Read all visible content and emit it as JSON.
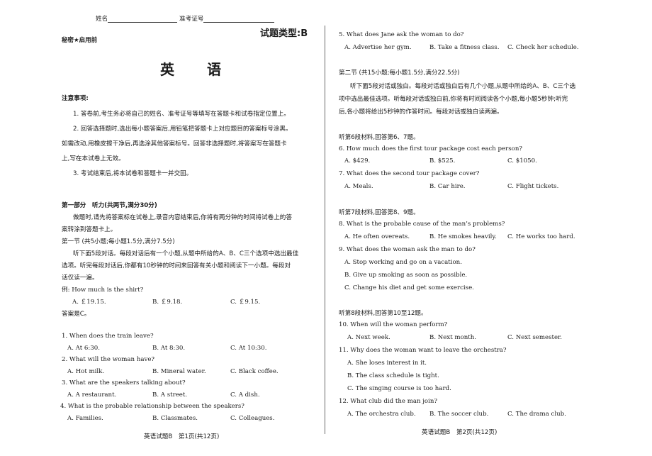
{
  "page1": {
    "header": {
      "name_label": "姓名",
      "exam_id_label": "准考证号",
      "paper_type": "试题类型:B",
      "confidential": "秘密★启用前"
    },
    "title": "英　　语",
    "notes": {
      "heading": "注意事项:",
      "item1": "1. 答卷前,考生务必将自己的姓名、准考证号等填写在答题卡和试卷指定位置上。",
      "item2_line1": "2. 回答选择题时,选出每小题答案后,用铅笔把答题卡上对应题目的答案标号涂黑。",
      "item2_line2": "如需改动,用橡皮擦干净后,再选涂其他答案标号。回答非选择题时,将答案写在答题卡",
      "item2_line3": "上,写在本试卷上无效。",
      "item3": "3. 考试结束后,将本试卷和答题卡一并交回。"
    },
    "part1": {
      "heading": "第一部分　听力(共两节,满分30分)",
      "instr_line1": "做题时,请先将答案标在试卷上,录音内容结束后,你将有两分钟的时间将试卷上的答",
      "instr_line2": "案转涂到答题卡上。",
      "section1_heading": "第一节 (共5小题;每小题1.5分,满分7.5分)",
      "section1_line1": "听下面5段对话。每段对话后有一个小题,从题中所给的A、B、C三个选项中选出最佳",
      "section1_line2": "选项。听完每段对话后,你都有10秒钟的时间来回答有关小题和阅读下一小题。每段对",
      "section1_line3": "话仅读一遍。"
    },
    "example": {
      "question": "例: How much is the shirt?",
      "options": [
        "A. ￡19.15.",
        "B. ￡9.18.",
        "C. ￡9.15."
      ],
      "answer": "答案是C。"
    },
    "questions": [
      {
        "q": "1. When does the train leave?",
        "options": [
          "A. At 6:30.",
          "B. At 8:30.",
          "C. At 10:30."
        ]
      },
      {
        "q": "2. What will the woman have?",
        "options": [
          "A. Hot milk.",
          "B. Mineral water.",
          "C. Black coffee."
        ]
      },
      {
        "q": "3. What are the speakers talking about?",
        "options": [
          "A. A restaurant.",
          "B. A street.",
          "C. A dish."
        ]
      },
      {
        "q": "4. What is the probable relationship between the speakers?",
        "options": [
          "A. Families.",
          "B. Classmates.",
          "C. Colleagues."
        ]
      }
    ],
    "footer": "英语试题B　第1页(共12页)"
  },
  "page2": {
    "q5": {
      "q": "5. What does Jane ask the woman to do?",
      "options": [
        "A. Advertise her gym.",
        "B. Take a fitness class.",
        "C. Check her schedule."
      ]
    },
    "section2": {
      "heading": "第二节 (共15小题;每小题1.5分,满分22.5分)",
      "line1": "听下面5段对话或独白。每段对话或独白后有几个小题,从题中所给的A、B、C三个选",
      "line2": "项中选出最佳选项。听每段对话或独白前,你将有时间阅读各个小题,每小题5秒钟;听完",
      "line3": "后,各小题将给出5秒钟的作答时间。每段对话或独白读两遍。"
    },
    "group6": {
      "intro": "听第6段材料,回答第6、7题。",
      "questions": [
        {
          "q": "6. How much does the first tour package cost each person?",
          "options": [
            "A. $429.",
            "B. $525.",
            "C. $1050."
          ]
        },
        {
          "q": "7. What does the second tour package cover?",
          "options": [
            "A. Meals.",
            "B. Car hire.",
            "C. Flight tickets."
          ]
        }
      ]
    },
    "group7": {
      "intro": "听第7段材料,回答第8、9题。",
      "q8": {
        "q": "8. What is the probable cause of the man’s problems?",
        "options": [
          "A. He often overeats.",
          "B. He smokes heavily.",
          "C. He works too hard."
        ]
      },
      "q9": {
        "q": "9. What does the woman ask the man to do?",
        "options": [
          "A. Stop working and go on a vacation.",
          "B. Give up smoking as soon as possible.",
          "C. Change his diet and get some exercise."
        ]
      }
    },
    "group8": {
      "intro": "听第8段材料,回答第10至12题。",
      "q10": {
        "q": "10. When will the woman perform?",
        "options": [
          "A. Next week.",
          "B. Next month.",
          "C. Next semester."
        ]
      },
      "q11": {
        "q": "11. Why does the woman want to leave the orchestra?",
        "options": [
          "A. She loses interest in it.",
          "B. The class schedule is tight.",
          "C. The singing course is too hard."
        ]
      },
      "q12": {
        "q": "12. What club did the man join?",
        "options": [
          "A. The orchestra club.",
          "B. The soccer club.",
          "C. The drama club."
        ]
      }
    },
    "footer": "英语试题B　第2页(共12页)"
  }
}
